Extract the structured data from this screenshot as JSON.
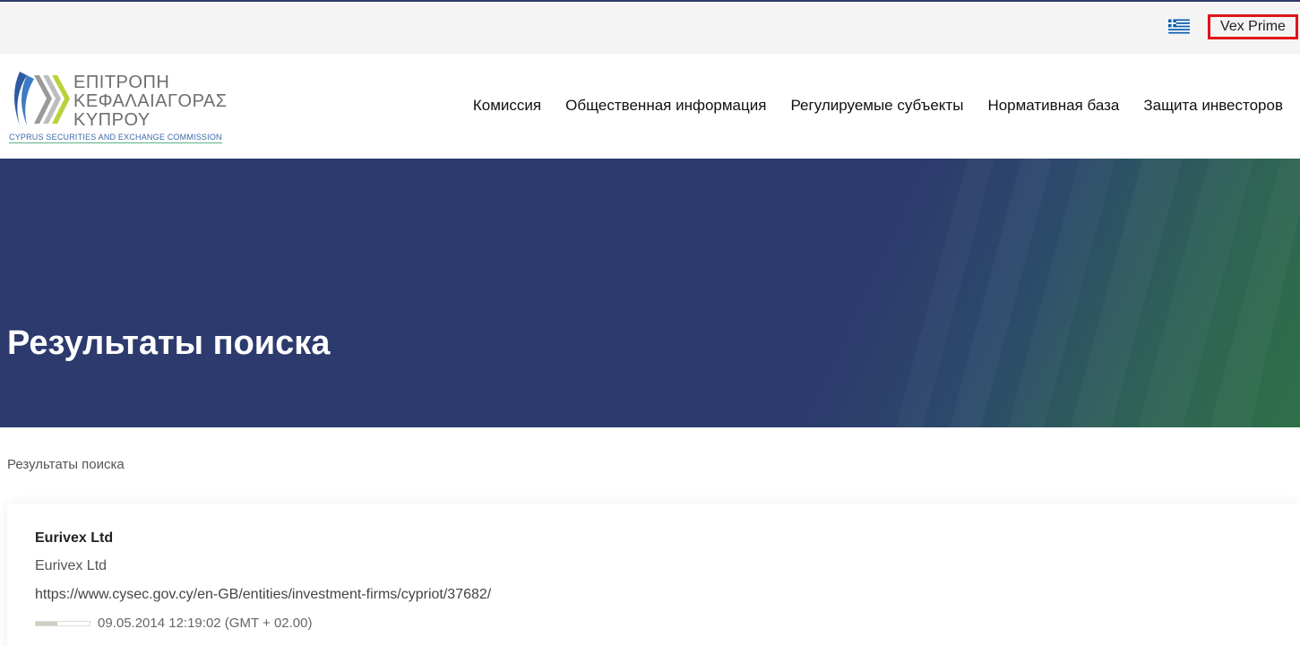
{
  "topbar": {
    "language_flag": "greece-flag-icon",
    "account_label": "Vex Prime"
  },
  "header": {
    "logo": {
      "line1": "ΕΠΙΤΡΟΠΗ",
      "line2": "ΚΕΦΑΛΑΙΑΓΟΡΑΣ",
      "line3": "ΚΥΠΡΟΥ",
      "subtitle": "CYPRUS SECURITIES AND EXCHANGE COMMISSION"
    },
    "nav": [
      {
        "label": "Комиссия"
      },
      {
        "label": "Общественная информация"
      },
      {
        "label": "Регулируемые субъекты"
      },
      {
        "label": "Нормативная база"
      },
      {
        "label": "Защита инвесторов"
      }
    ]
  },
  "hero": {
    "title": "Результаты поиска"
  },
  "breadcrumb": "Результаты поиска",
  "results": [
    {
      "title": "Eurivex Ltd",
      "subtitle": "Eurivex Ltd",
      "url": "https://www.cysec.gov.cy/en-GB/entities/investment-firms/cypriot/37682/",
      "relevance": 0.4,
      "date": "09.05.2014 12:19:02 (GMT + 02.00)"
    }
  ],
  "colors": {
    "hero_blue": "#2c3a6e",
    "hero_green": "#2e7048",
    "highlight_border": "#e0141b"
  }
}
